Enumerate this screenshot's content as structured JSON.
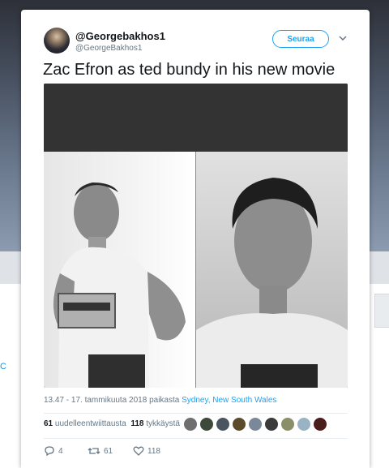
{
  "tweet": {
    "display_name": "@Georgebakhos1",
    "handle": "@GeorgeBakhos1",
    "follow_label": "Seuraa",
    "text": "Zac Efron as ted bundy in his new movie",
    "timestamp_prefix": "13.47 - 17. tammikuuta 2018 paikasta ",
    "location": "Sydney, New South Wales",
    "retweets_count": "61",
    "retweets_label": "uudelleentwiittausta",
    "likes_count": "118",
    "likes_label": "tykkäystä",
    "reply_count": "4",
    "retweet_action_count": "61",
    "like_action_count": "118"
  },
  "background": {
    "left_link_fragment": "C"
  },
  "colors": {
    "accent": "#1da1f2",
    "text": "#14171a",
    "muted": "#657786"
  },
  "icons": [
    "chevron-down-icon",
    "reply-icon",
    "retweet-icon",
    "like-icon"
  ]
}
